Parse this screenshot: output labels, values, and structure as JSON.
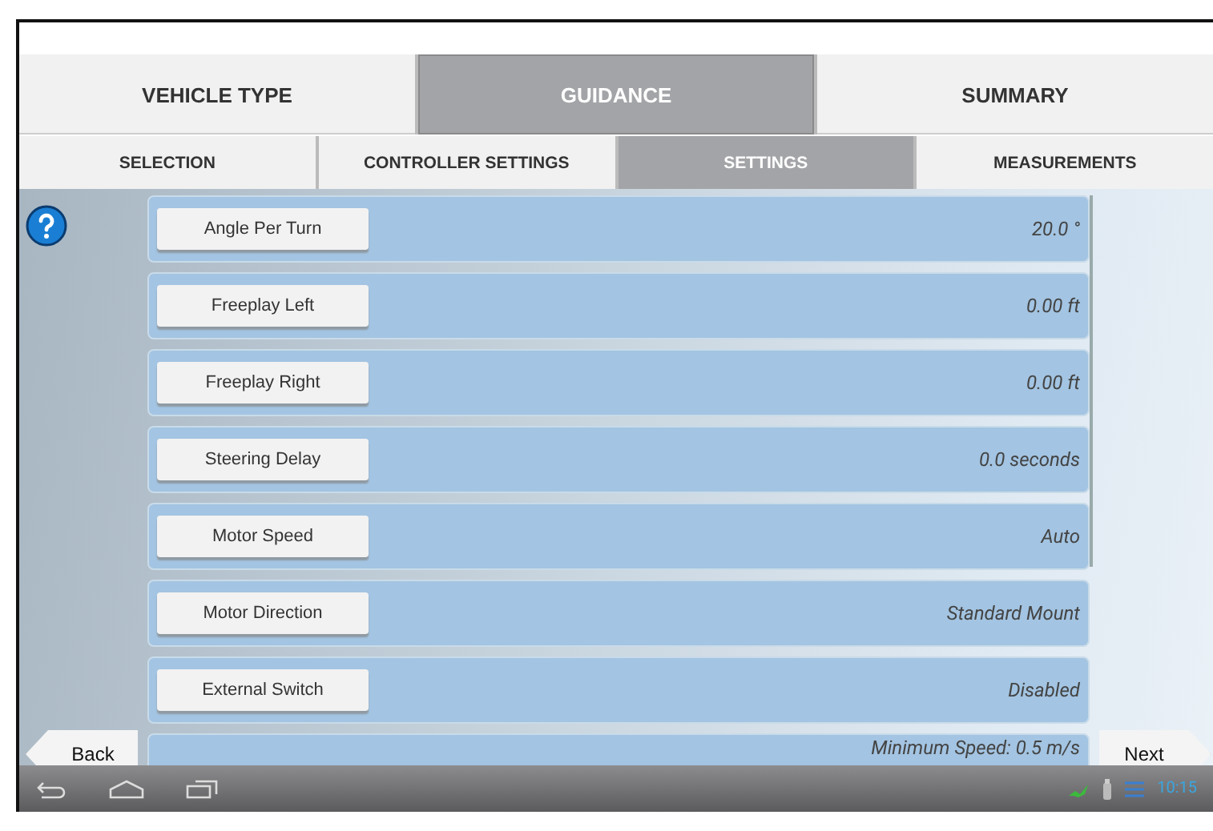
{
  "top_tabs": [
    {
      "label": "VEHICLE TYPE",
      "selected": false
    },
    {
      "label": "GUIDANCE",
      "selected": true
    },
    {
      "label": "SUMMARY",
      "selected": false
    }
  ],
  "sub_tabs": [
    {
      "label": "SELECTION",
      "selected": false
    },
    {
      "label": "CONTROLLER SETTINGS",
      "selected": false
    },
    {
      "label": "SETTINGS",
      "selected": true
    },
    {
      "label": "MEASUREMENTS",
      "selected": false
    }
  ],
  "settings": [
    {
      "label": "Angle Per Turn",
      "value": "20.0 °"
    },
    {
      "label": "Freeplay Left",
      "value": "0.00 ft"
    },
    {
      "label": "Freeplay Right",
      "value": "0.00 ft"
    },
    {
      "label": "Steering Delay",
      "value": "0.0 seconds"
    },
    {
      "label": "Motor Speed",
      "value": "Auto"
    },
    {
      "label": "Motor Direction",
      "value": "Standard Mount"
    },
    {
      "label": "External Switch",
      "value": "Disabled"
    },
    {
      "value": "Minimum Speed: 0.5 m/s"
    }
  ],
  "back_button": "Back",
  "next_button": "Next",
  "status_bar": {
    "time": "10:15"
  }
}
